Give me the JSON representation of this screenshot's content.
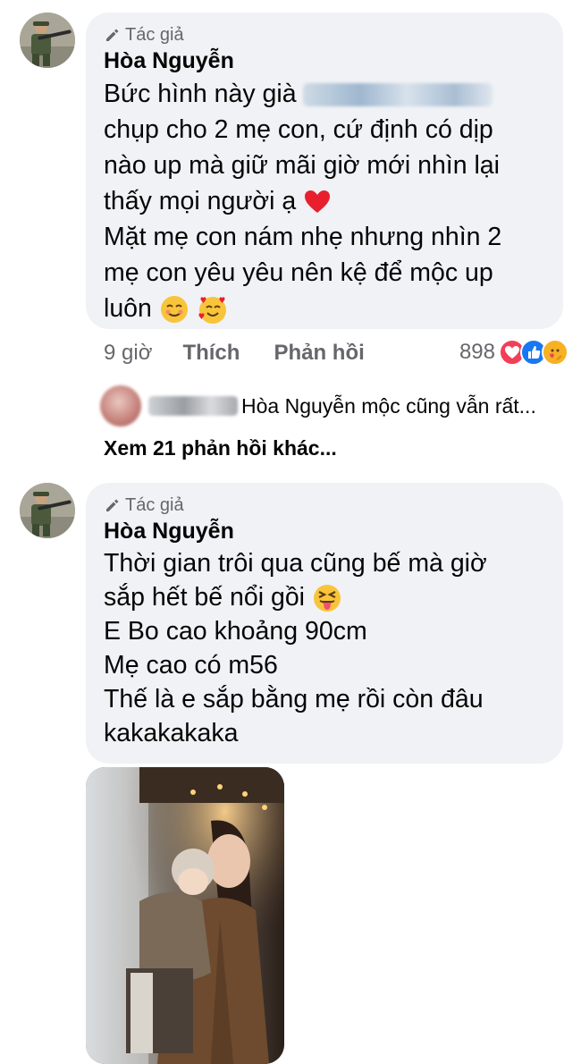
{
  "comments": [
    {
      "badge_label": "Tác giả",
      "author": "Hòa Nguyễn",
      "line1_prefix": "Bức hình này già",
      "line2": "chụp cho 2 mẹ con, cứ định có dịp",
      "line3": "nào up mà giữ mãi giờ mới nhìn lại",
      "line4": "thấy mọi người ạ",
      "line5": "Mặt mẹ con nám nhẹ nhưng nhìn 2",
      "line6": "mẹ con yêu yêu nên kệ để mộc up",
      "line7": "luôn",
      "time": "9 giờ",
      "like_label": "Thích",
      "reply_label": "Phản hồi",
      "reaction_count": "898",
      "reaction_icons": [
        "love-reaction-icon",
        "like-reaction-icon",
        "care-reaction-icon"
      ],
      "line4_emoji": "red-heart-icon",
      "line7_emojis": [
        "smiling-face-icon",
        "smiling-face-with-hearts-icon"
      ]
    },
    {
      "badge_label": "Tác giả",
      "author": "Hòa Nguyễn",
      "line1": "Thời gian trôi qua cũng bế mà giờ",
      "line2_prefix": "sắp hết bế nổi gồi",
      "line3": "E Bo cao khoảng 90cm",
      "line4": "Mẹ cao có m56",
      "line5": "Thế là e sắp bằng mẹ rồi còn đâu",
      "line6": "kakakakaka",
      "line2_emoji": "squinting-face-with-tongue-icon"
    }
  ],
  "reply_preview": {
    "text": "Hòa Nguyễn mộc cũng vẫn rất..."
  },
  "view_more_label": "Xem 21 phản hồi khác...",
  "colors": {
    "bubble": "#f0f2f5",
    "secondary_text": "#65676b",
    "love": "#f33e58",
    "like": "#1877f2",
    "care": "#f7b125"
  }
}
